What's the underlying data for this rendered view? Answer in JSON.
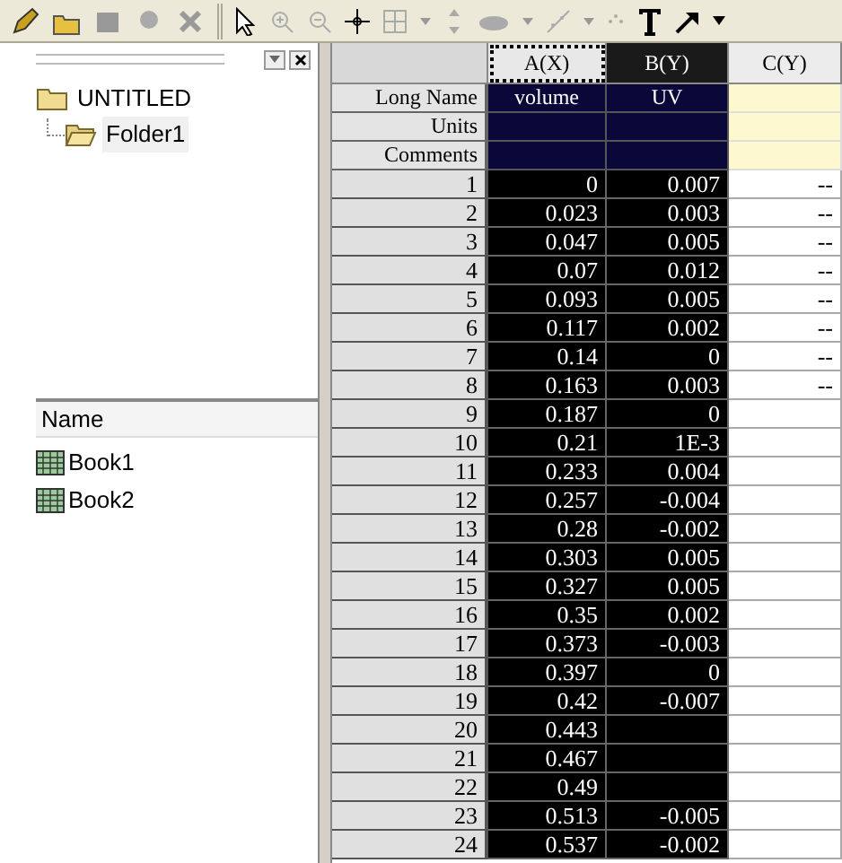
{
  "project_tree": [
    {
      "label": "UNTITLED",
      "children": [
        {
          "label": "Folder1",
          "selected": true
        }
      ]
    }
  ],
  "file_list": {
    "header": "Name",
    "items": [
      {
        "label": "Book1"
      },
      {
        "label": "Book2"
      }
    ]
  },
  "worksheet": {
    "columns": [
      {
        "header": "A(X)",
        "long_name": "volume",
        "selected": true,
        "active": true
      },
      {
        "header": "B(Y)",
        "long_name": "UV",
        "selected": true,
        "active": false
      },
      {
        "header": "C(Y)",
        "selected": false,
        "active": false
      }
    ],
    "label_rows": [
      "Long Name",
      "Units",
      "Comments"
    ],
    "rows": [
      {
        "n": "1",
        "cells": [
          "0",
          "0.007",
          "--"
        ]
      },
      {
        "n": "2",
        "cells": [
          "0.023",
          "0.003",
          "--"
        ]
      },
      {
        "n": "3",
        "cells": [
          "0.047",
          "0.005",
          "--"
        ]
      },
      {
        "n": "4",
        "cells": [
          "0.07",
          "0.012",
          "--"
        ]
      },
      {
        "n": "5",
        "cells": [
          "0.093",
          "0.005",
          "--"
        ]
      },
      {
        "n": "6",
        "cells": [
          "0.117",
          "0.002",
          "--"
        ]
      },
      {
        "n": "7",
        "cells": [
          "0.14",
          "0",
          "--"
        ]
      },
      {
        "n": "8",
        "cells": [
          "0.163",
          "0.003",
          "--"
        ]
      },
      {
        "n": "9",
        "cells": [
          "0.187",
          "0",
          ""
        ]
      },
      {
        "n": "10",
        "cells": [
          "0.21",
          "1E-3",
          ""
        ]
      },
      {
        "n": "11",
        "cells": [
          "0.233",
          "0.004",
          ""
        ]
      },
      {
        "n": "12",
        "cells": [
          "0.257",
          "-0.004",
          ""
        ]
      },
      {
        "n": "13",
        "cells": [
          "0.28",
          "-0.002",
          ""
        ]
      },
      {
        "n": "14",
        "cells": [
          "0.303",
          "0.005",
          ""
        ]
      },
      {
        "n": "15",
        "cells": [
          "0.327",
          "0.005",
          ""
        ]
      },
      {
        "n": "16",
        "cells": [
          "0.35",
          "0.002",
          ""
        ]
      },
      {
        "n": "17",
        "cells": [
          "0.373",
          "-0.003",
          ""
        ]
      },
      {
        "n": "18",
        "cells": [
          "0.397",
          "0",
          ""
        ]
      },
      {
        "n": "19",
        "cells": [
          "0.42",
          "-0.007",
          ""
        ]
      },
      {
        "n": "20",
        "cells": [
          "0.443",
          "",
          ""
        ]
      },
      {
        "n": "21",
        "cells": [
          "0.467",
          "",
          ""
        ]
      },
      {
        "n": "22",
        "cells": [
          "0.49",
          "",
          ""
        ]
      },
      {
        "n": "23",
        "cells": [
          "0.513",
          "-0.005",
          ""
        ]
      },
      {
        "n": "24",
        "cells": [
          "0.537",
          "-0.002",
          ""
        ]
      }
    ]
  }
}
